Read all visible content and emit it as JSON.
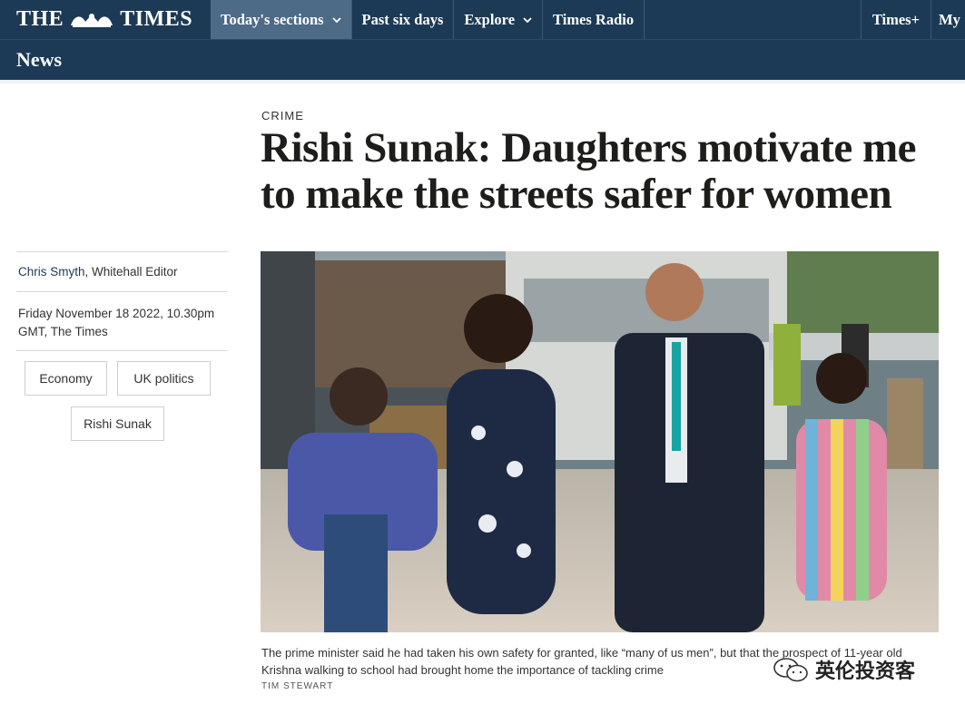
{
  "masthead": {
    "logo_left": "THE",
    "logo_right": "TIMES"
  },
  "nav": {
    "items": [
      {
        "label": "Today's sections",
        "has_dropdown": true,
        "active": true
      },
      {
        "label": "Past six days",
        "has_dropdown": false
      },
      {
        "label": "Explore",
        "has_dropdown": true
      },
      {
        "label": "Times Radio",
        "has_dropdown": false
      }
    ],
    "right_items": [
      {
        "label": "Times+"
      },
      {
        "label": "My"
      }
    ]
  },
  "section": {
    "title": "News"
  },
  "article": {
    "kicker": "CRIME",
    "headline_line1": "Rishi Sunak: Daughters motivate me",
    "headline_line2": "to make the streets safer for women",
    "author_name": "Chris Smyth",
    "author_role": ", Whitehall Editor",
    "date_line1": "Friday November 18 2022, 10.30pm",
    "date_line2": "GMT, The Times",
    "tags": [
      "Economy",
      "UK politics",
      "Rishi Sunak"
    ],
    "caption_line1": "The prime minister said he had taken his own safety for granted, like “many of us men”, but that the prospect of 11-year old",
    "caption_line2": "Krishna walking to school had brought home the importance of tackling crime",
    "photo_credit": "TIM STEWART"
  },
  "watermark": {
    "text": "英伦投资客"
  },
  "colors": {
    "nav_bg": "#1c3a55",
    "nav_active": "#4d6a86",
    "author_link": "#1c3a55"
  }
}
